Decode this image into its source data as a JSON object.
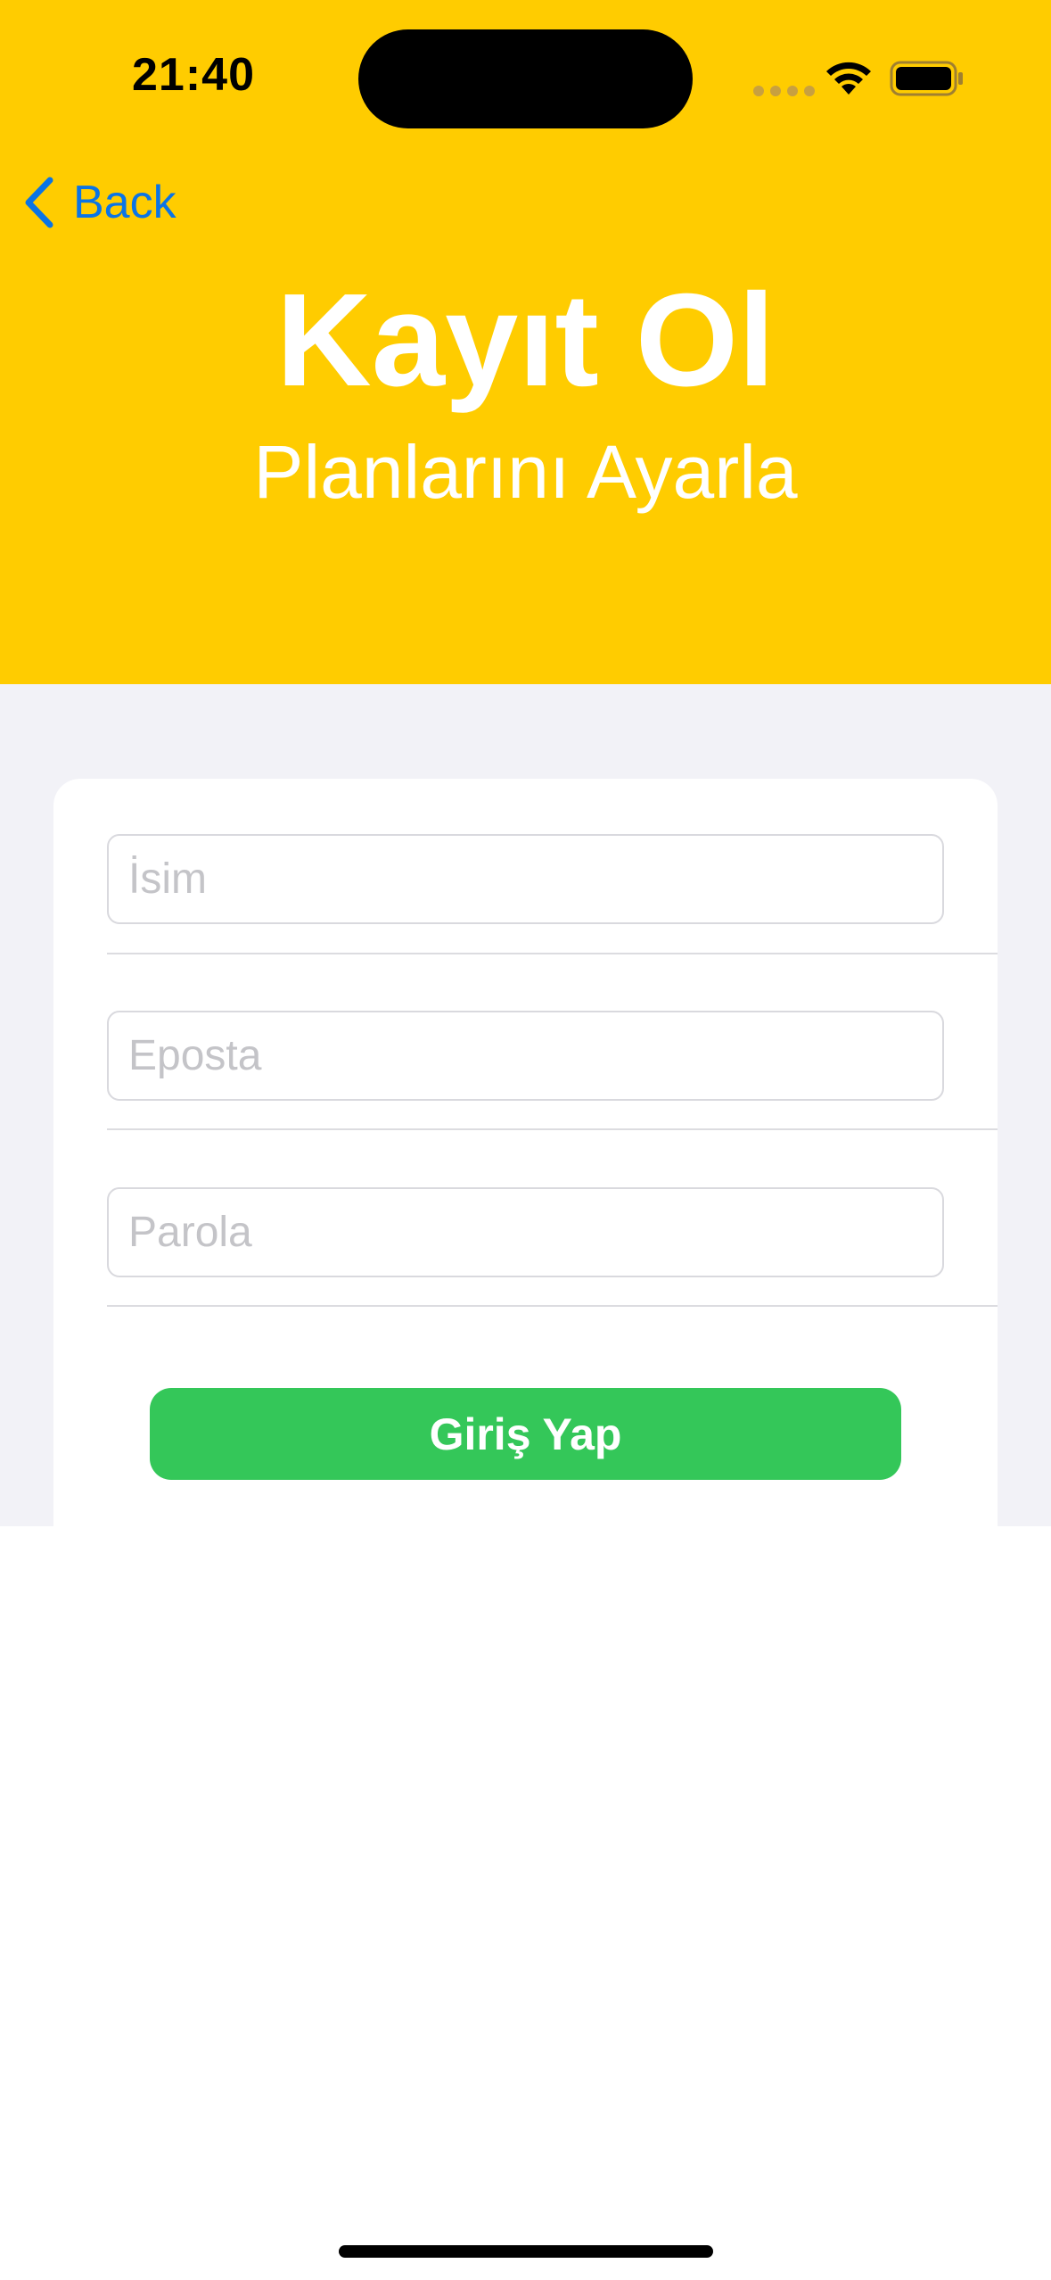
{
  "status_bar": {
    "time": "21:40"
  },
  "nav": {
    "back_label": "Back"
  },
  "header": {
    "title": "Kayıt Ol",
    "subtitle": "Planlarını Ayarla"
  },
  "form": {
    "name_placeholder": "İsim",
    "name_value": "",
    "email_placeholder": "Eposta",
    "email_value": "",
    "password_placeholder": "Parola",
    "password_value": "",
    "submit_label": "Giriş Yap"
  },
  "colors": {
    "header_background": "#FFCC00",
    "accent_blue": "#0A74E6",
    "button_green": "#34C759",
    "grouped_background": "#F2F2F7"
  },
  "icons": {
    "back": "chevron-left-icon",
    "wifi": "wifi-icon",
    "battery": "battery-icon",
    "cellular": "cellular-signal-icon"
  }
}
